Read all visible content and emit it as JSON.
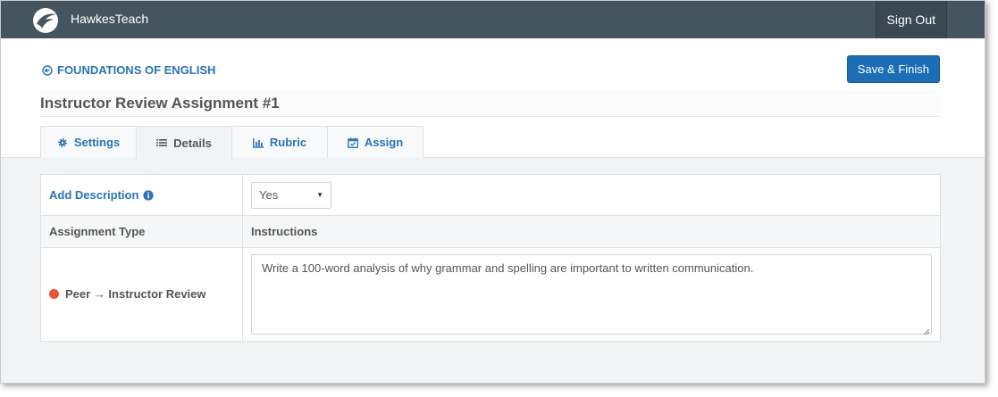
{
  "topbar": {
    "brand": "HawkesTeach",
    "sign_out": "Sign Out"
  },
  "header": {
    "back_link": "FOUNDATIONS OF ENGLISH",
    "save_button": "Save & Finish",
    "page_title": "Instructor Review Assignment #1"
  },
  "tabs": [
    {
      "label": "Settings",
      "icon": "gear-icon"
    },
    {
      "label": "Details",
      "icon": "list-icon",
      "active": true
    },
    {
      "label": "Rubric",
      "icon": "bar-chart-icon"
    },
    {
      "label": "Assign",
      "icon": "calendar-check-icon"
    }
  ],
  "details": {
    "add_description_label": "Add Description",
    "add_description_value": "Yes",
    "col_assignment_type": "Assignment Type",
    "col_instructions": "Instructions",
    "assignment_type": "Peer → Instructor Review",
    "instructions": "Write a 100-word analysis of why grammar and spelling are important to written communication."
  },
  "colors": {
    "topbar": "#455560",
    "accent": "#2a73b4",
    "primary_button": "#1c6db5",
    "status_dot": "#e8553e"
  }
}
